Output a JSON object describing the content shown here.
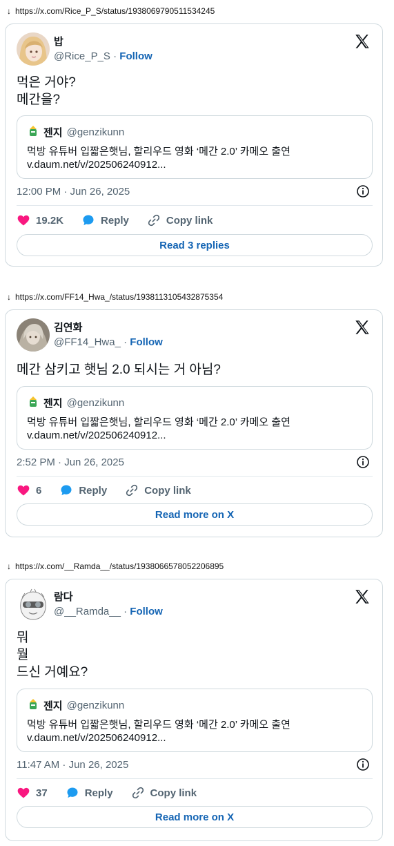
{
  "colors": {
    "accent": "#1d9bf0",
    "like": "#f91880",
    "link_text": "#1565b4",
    "border": "#cfd9de",
    "muted": "#536471"
  },
  "icons": {
    "like": "heart-icon",
    "reply": "speech-bubble-icon",
    "copy": "link-icon",
    "info": "info-icon",
    "logo": "x-logo-icon",
    "download": "down-arrow-icon"
  },
  "posts": [
    {
      "url_arrow": "↓",
      "url": "https://x.com/Rice_P_S/status/1938069790511534245",
      "author_name": "밥",
      "handle": "@Rice_P_S",
      "separator": "·",
      "follow": "Follow",
      "text_lines": [
        "먹은 거야?",
        "메간을?"
      ],
      "quote": {
        "name": "젠지",
        "handle": "@genzikunn",
        "line1": "먹방 유튜버 입짧은햇님, 할리우드 영화 ‘메간 2.0’ 카메오 출연",
        "line2": "v.daum.net/v/202506240912..."
      },
      "timestamp": "12:00 PM · Jun 26, 2025",
      "likes": "19.2K",
      "reply": "Reply",
      "copy_link": "Copy link",
      "read_more": "Read 3 replies"
    },
    {
      "url_arrow": "↓",
      "url": "https://x.com/FF14_Hwa_/status/1938113105432875354",
      "author_name": "김연화",
      "handle": "@FF14_Hwa_",
      "separator": "·",
      "follow": "Follow",
      "text_lines": [
        "메간 삼키고 햇님 2.0 되시는 거 아님?"
      ],
      "quote": {
        "name": "젠지",
        "handle": "@genzikunn",
        "line1": "먹방 유튜버 입짧은햇님, 할리우드 영화 ‘메간 2.0’ 카메오 출연",
        "line2": "v.daum.net/v/202506240912..."
      },
      "timestamp": "2:52 PM · Jun 26, 2025",
      "likes": "6",
      "reply": "Reply",
      "copy_link": "Copy link",
      "read_more": "Read more on X"
    },
    {
      "url_arrow": "↓",
      "url": "https://x.com/__Ramda__/status/1938066578052206895",
      "author_name": "람다",
      "handle": "@__Ramda__",
      "separator": "·",
      "follow": "Follow",
      "text_lines": [
        "뭐",
        "뭘",
        "드신 거예요?"
      ],
      "quote": {
        "name": "젠지",
        "handle": "@genzikunn",
        "line1": "먹방 유튜버 입짧은햇님, 할리우드 영화 ‘메간 2.0’ 카메오 출연",
        "line2": "v.daum.net/v/202506240912..."
      },
      "timestamp": "11:47 AM · Jun 26, 2025",
      "likes": "37",
      "reply": "Reply",
      "copy_link": "Copy link",
      "read_more": "Read more on X"
    }
  ]
}
